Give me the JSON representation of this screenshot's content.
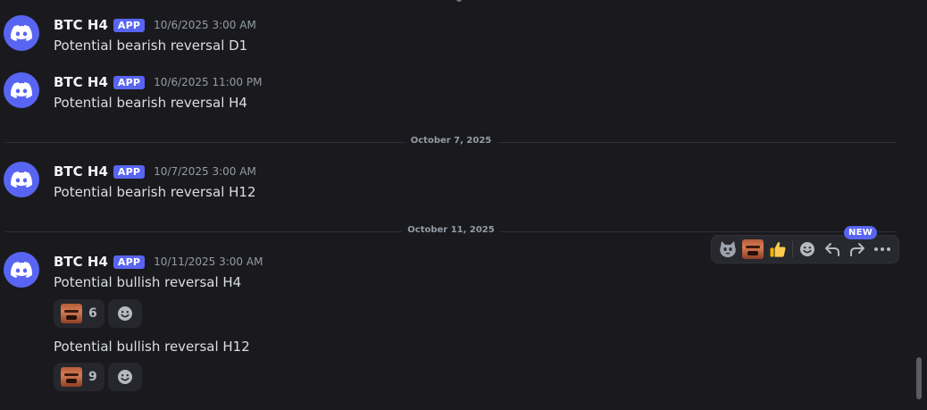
{
  "messages": [
    {
      "author": "BTC H4",
      "badge": "APP",
      "timestamp": "10/6/2025 3:00 AM",
      "text": "Potential bearish reversal D1"
    },
    {
      "author": "BTC H4",
      "badge": "APP",
      "timestamp": "10/6/2025 11:00 PM",
      "text": "Potential bearish reversal H4"
    },
    {
      "author": "BTC H4",
      "badge": "APP",
      "timestamp": "10/7/2025 3:00 AM",
      "text": "Potential bearish reversal H12"
    },
    {
      "author": "BTC H4",
      "badge": "APP",
      "timestamp": "10/11/2025 3:00 AM",
      "text": "Potential bullish reversal H4"
    }
  ],
  "followup_message": {
    "text": "Potential bullish reversal H12"
  },
  "dividers": [
    "October 7, 2025",
    "October 11, 2025"
  ],
  "reactions": [
    {
      "emoji": "face-emoji",
      "count": "6"
    },
    {
      "emoji": "face-emoji",
      "count": "9"
    }
  ],
  "toolbar": {
    "new_badge": "NEW",
    "items": [
      "cat-emoji",
      "face-emoji",
      "thumbs-up-emoji",
      "add-reaction-icon",
      "reply-icon",
      "forward-icon",
      "more-icon"
    ]
  },
  "colors": {
    "background": "#1a1a1e",
    "blurple": "#5865f2",
    "text": "#dbdee1",
    "muted": "#949ba4"
  }
}
